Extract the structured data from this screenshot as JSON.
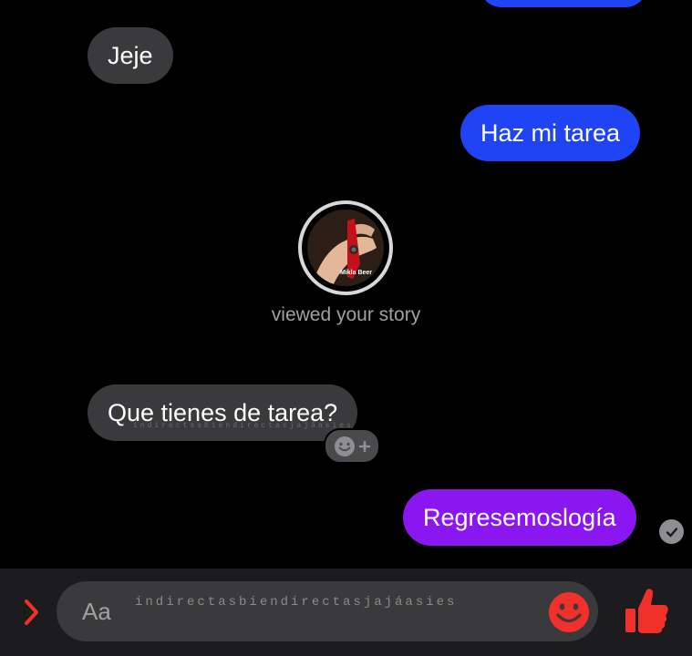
{
  "messages": [
    {
      "id": "jeje",
      "text": "Jeje",
      "direction": "incoming"
    },
    {
      "id": "haz",
      "text": "Haz mi tarea",
      "direction": "outgoing"
    },
    {
      "id": "que",
      "text": "Que tienes de tarea?",
      "direction": "incoming"
    },
    {
      "id": "regres",
      "text": "Regresemoslogía",
      "direction": "outgoing"
    }
  ],
  "story": {
    "caption": "viewed your story",
    "thumbnail_text": "Mikla Beer"
  },
  "watermarks": {
    "bubble": "indirectasbiendirectasjajáasies",
    "composer": "indirectasbiendirectasjajáasies"
  },
  "composer": {
    "placeholder": "Aa"
  },
  "icons": {
    "expand": "chevron-right-icon",
    "emoji": "smiley-icon",
    "like": "thumbs-up-icon",
    "react": "add-reaction-icon",
    "seen": "sent-check-icon"
  },
  "colors": {
    "background": "#000000",
    "incoming_bubble": "#3a3a3c",
    "outgoing_blue": "#1f44f5",
    "outgoing_purple": "#8a16f2",
    "accent": "#f0302a"
  }
}
